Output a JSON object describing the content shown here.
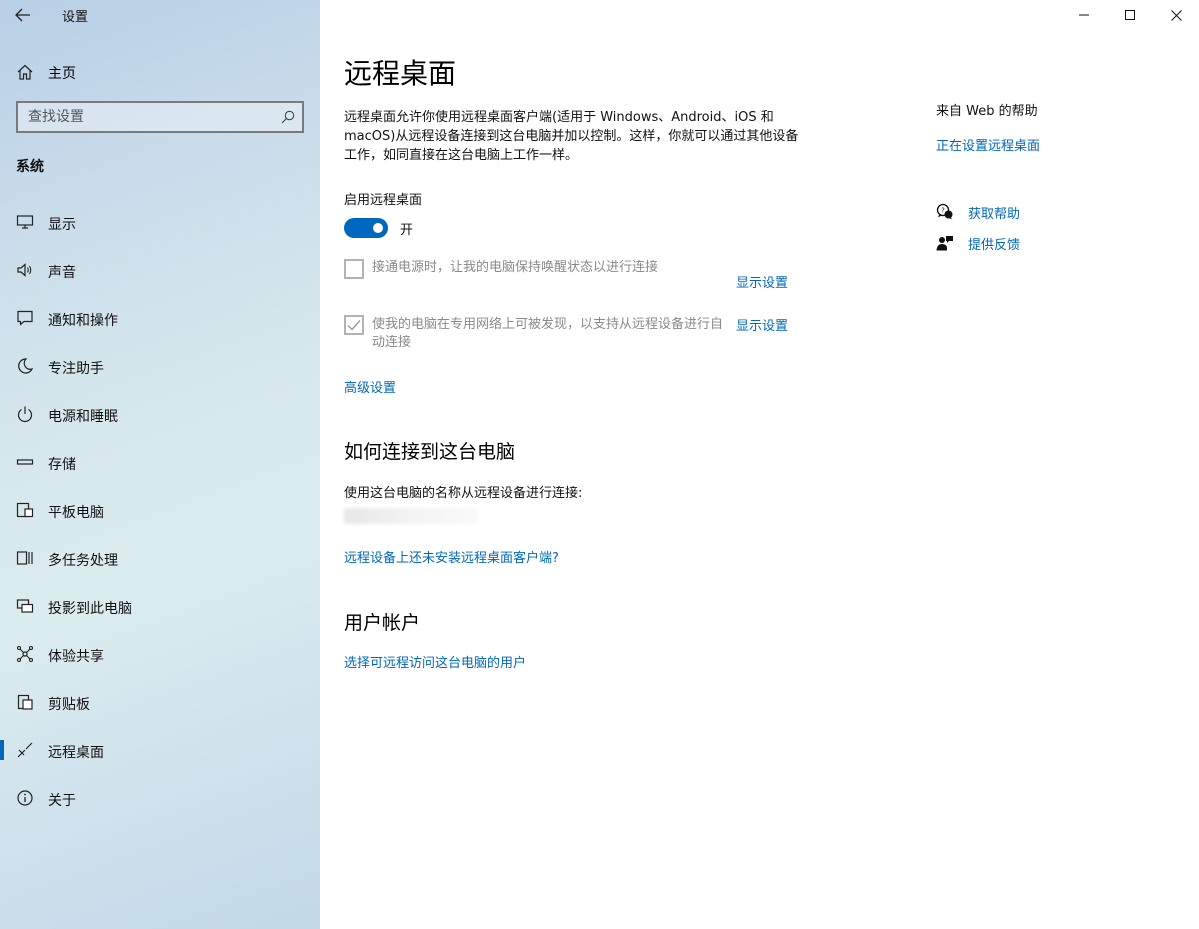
{
  "window": {
    "title": "设置",
    "controls": [
      "minimize",
      "maximize",
      "close"
    ]
  },
  "sidebar": {
    "home_label": "主页",
    "search": {
      "placeholder": "查找设置"
    },
    "section_title": "系统",
    "items": [
      {
        "label": "显示",
        "icon": "monitor-icon",
        "active": false
      },
      {
        "label": "声音",
        "icon": "speaker-icon",
        "active": false
      },
      {
        "label": "通知和操作",
        "icon": "notification-icon",
        "active": false
      },
      {
        "label": "专注助手",
        "icon": "moon-icon",
        "active": false
      },
      {
        "label": "电源和睡眠",
        "icon": "power-icon",
        "active": false
      },
      {
        "label": "存储",
        "icon": "storage-icon",
        "active": false
      },
      {
        "label": "平板电脑",
        "icon": "tablet-icon",
        "active": false
      },
      {
        "label": "多任务处理",
        "icon": "multitask-icon",
        "active": false
      },
      {
        "label": "投影到此电脑",
        "icon": "project-icon",
        "active": false
      },
      {
        "label": "体验共享",
        "icon": "share-icon",
        "active": false
      },
      {
        "label": "剪贴板",
        "icon": "clipboard-icon",
        "active": false
      },
      {
        "label": "远程桌面",
        "icon": "remote-desktop-icon",
        "active": true
      },
      {
        "label": "关于",
        "icon": "info-icon",
        "active": false
      }
    ]
  },
  "main": {
    "title": "远程桌面",
    "intro": "远程桌面允许你使用远程桌面客户端(适用于 Windows、Android、iOS 和 macOS)从远程设备连接到这台电脑并加以控制。这样，你就可以通过其他设备工作，如同直接在这台电脑上工作一样。",
    "enable_label": "启用远程桌面",
    "toggle_state": "开",
    "toggle_on": true,
    "checkbox1_label": "接通电源时，让我的电脑保持唤醒状态以进行连接",
    "checkbox1_checked": false,
    "checkbox2_label": "使我的电脑在专用网络上可被发现，以支持从远程设备进行自动连接",
    "checkbox2_checked": true,
    "show_settings_1": "显示设置",
    "show_settings_2": "显示设置",
    "advanced_link": "高级设置",
    "connect_heading": "如何连接到这台电脑",
    "connect_desc": "使用这台电脑的名称从远程设备进行连接:",
    "client_link": "远程设备上还未安装远程桌面客户端?",
    "users_heading": "用户帐户",
    "users_link": "选择可远程访问这台电脑的用户"
  },
  "help": {
    "title": "来自 Web 的帮助",
    "setup_link": "正在设置远程桌面",
    "get_help": "获取帮助",
    "feedback": "提供反馈"
  },
  "colors": {
    "accent": "#0067c0",
    "link": "#0067b8",
    "disabled_text": "#8a8a8a"
  }
}
